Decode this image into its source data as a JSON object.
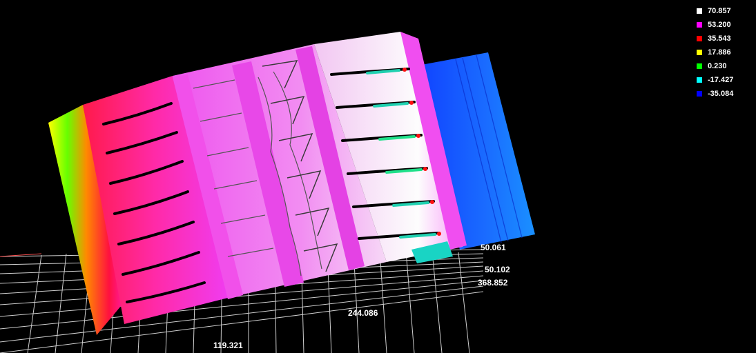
{
  "legend": [
    {
      "value": "70.857",
      "color": "#ffffff"
    },
    {
      "value": "53.200",
      "color": "#ff00ff"
    },
    {
      "value": "35.543",
      "color": "#ff0000"
    },
    {
      "value": "17.886",
      "color": "#ffff00"
    },
    {
      "value": "0.230",
      "color": "#00ff00"
    },
    {
      "value": "-17.427",
      "color": "#00ffff"
    },
    {
      "value": "-35.084",
      "color": "#0000ff"
    }
  ],
  "axis_labels": {
    "x1": "119.321",
    "x2": "244.086",
    "x3": "368.852",
    "y1": "50.102",
    "z1": "50.061"
  }
}
